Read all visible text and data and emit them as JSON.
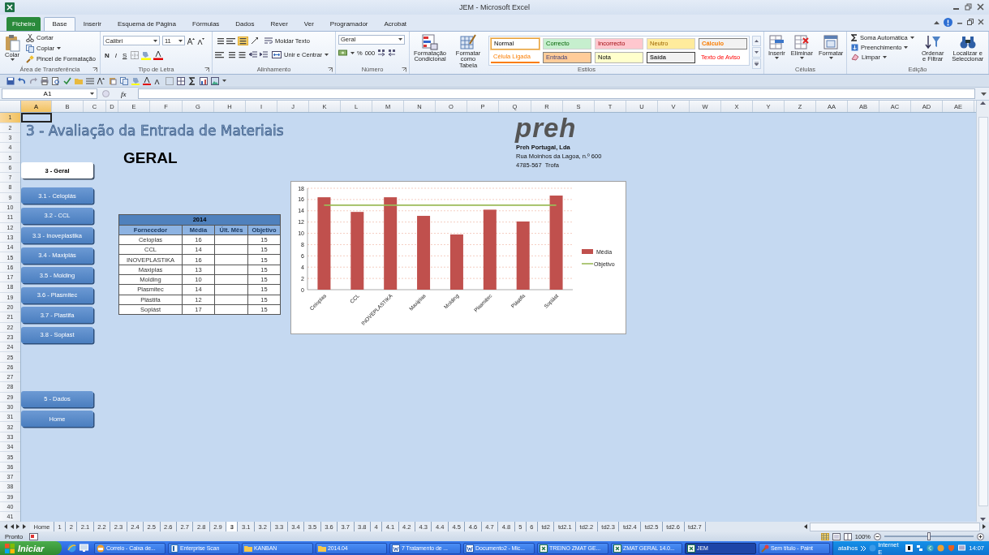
{
  "title_bar": {
    "title": "JEM - Microsoft Excel"
  },
  "ribbon_tabs": [
    {
      "label": "Ficheiro",
      "kind": "file",
      "selected": false
    },
    {
      "label": "Base",
      "kind": "tab",
      "selected": true
    },
    {
      "label": "Inserir",
      "kind": "tab",
      "selected": false
    },
    {
      "label": "Esquema de Página",
      "kind": "tab",
      "selected": false
    },
    {
      "label": "Fórmulas",
      "kind": "tab",
      "selected": false
    },
    {
      "label": "Dados",
      "kind": "tab",
      "selected": false
    },
    {
      "label": "Rever",
      "kind": "tab",
      "selected": false
    },
    {
      "label": "Ver",
      "kind": "tab",
      "selected": false
    },
    {
      "label": "Programador",
      "kind": "tab",
      "selected": false
    },
    {
      "label": "Acrobat",
      "kind": "tab",
      "selected": false
    }
  ],
  "ribbon": {
    "clipboard": {
      "label": "Área de Transferência",
      "paste": "Colar",
      "cut": "Cortar",
      "copy": "Copiar",
      "format_painter": "Pincel de Formatação"
    },
    "font": {
      "label": "Tipo de Letra",
      "name": "Calibri",
      "size": "11",
      "buttons": [
        "N",
        "I",
        "S"
      ]
    },
    "alignment": {
      "label": "Alinhamento",
      "wrap": "Moldar Texto",
      "merge": "Unir e Centrar"
    },
    "number": {
      "label": "Número",
      "format": "Geral",
      "percent": "%",
      "thousands": "000"
    },
    "styles": {
      "label": "Estilos",
      "conditional": "Formatação Condicional",
      "as_table": "Formatar como Tabela",
      "items": [
        {
          "label": "Normal",
          "kind": "normal",
          "color": "#ffffff",
          "selected": true
        },
        {
          "label": "Correcto",
          "kind": "good",
          "color": "#c6efce",
          "selected": false
        },
        {
          "label": "Incorrecto",
          "kind": "bad",
          "color": "#ffc7ce",
          "selected": false
        },
        {
          "label": "Neutro",
          "kind": "neutral",
          "color": "#ffeb9c",
          "selected": false
        },
        {
          "label": "Cálculo",
          "kind": "calculation",
          "color": "#f2f2f2",
          "selected": false
        },
        {
          "label": "Célula Ligada",
          "kind": "linked",
          "color": "#ffffff",
          "selected": false
        },
        {
          "label": "Entrada",
          "kind": "input",
          "color": "#ffcc99",
          "selected": false
        },
        {
          "label": "Nota",
          "kind": "note",
          "color": "#ffffcc",
          "selected": false
        },
        {
          "label": "Saída",
          "kind": "output",
          "color": "#f2f2f2",
          "selected": false
        },
        {
          "label": "Texto de Aviso",
          "kind": "warning",
          "color": "#ffffff",
          "selected": false
        }
      ]
    },
    "cells": {
      "label": "Células",
      "insert": "Inserir",
      "delete": "Eliminar",
      "format": "Formatar"
    },
    "editing": {
      "label": "Edição",
      "autosum": "Soma Automática",
      "fill": "Preenchimento",
      "clear": "Limpar",
      "sort": "Ordenar e Filtrar",
      "find": "Localizar e Seleccionar"
    }
  },
  "formula_bar": {
    "name_box": "A1",
    "fx": "fx"
  },
  "sheet": {
    "columns": [
      {
        "label": "A",
        "selected": true
      },
      {
        "label": "B",
        "selected": false
      },
      {
        "label": "C",
        "selected": false
      },
      {
        "label": "D",
        "selected": false
      },
      {
        "label": "E",
        "selected": false
      },
      {
        "label": "F",
        "selected": false
      },
      {
        "label": "G",
        "selected": false
      },
      {
        "label": "H",
        "selected": false
      },
      {
        "label": "I",
        "selected": false
      },
      {
        "label": "J",
        "selected": false
      },
      {
        "label": "K",
        "selected": false
      },
      {
        "label": "L",
        "selected": false
      },
      {
        "label": "M",
        "selected": false
      },
      {
        "label": "N",
        "selected": false
      },
      {
        "label": "O",
        "selected": false
      },
      {
        "label": "P",
        "selected": false
      },
      {
        "label": "Q",
        "selected": false
      },
      {
        "label": "R",
        "selected": false
      },
      {
        "label": "S",
        "selected": false
      },
      {
        "label": "T",
        "selected": false
      },
      {
        "label": "U",
        "selected": false
      },
      {
        "label": "V",
        "selected": false
      },
      {
        "label": "W",
        "selected": false
      },
      {
        "label": "X",
        "selected": false
      },
      {
        "label": "Y",
        "selected": false
      },
      {
        "label": "Z",
        "selected": false
      },
      {
        "label": "AA",
        "selected": false
      },
      {
        "label": "AB",
        "selected": false
      },
      {
        "label": "AC",
        "selected": false
      },
      {
        "label": "AD",
        "selected": false
      },
      {
        "label": "AE",
        "selected": false
      }
    ],
    "rows": [
      {
        "label": "1",
        "selected": true
      },
      {
        "label": "2",
        "selected": false
      },
      {
        "label": "3",
        "selected": false
      },
      {
        "label": "4",
        "selected": false
      },
      {
        "label": "5",
        "selected": false
      },
      {
        "label": "6",
        "selected": false
      },
      {
        "label": "7",
        "selected": false
      },
      {
        "label": "8",
        "selected": false
      },
      {
        "label": "9",
        "selected": false
      },
      {
        "label": "10",
        "selected": false
      },
      {
        "label": "11",
        "selected": false
      },
      {
        "label": "12",
        "selected": false
      },
      {
        "label": "13",
        "selected": false
      },
      {
        "label": "14",
        "selected": false
      },
      {
        "label": "15",
        "selected": false
      },
      {
        "label": "16",
        "selected": false
      },
      {
        "label": "17",
        "selected": false
      },
      {
        "label": "18",
        "selected": false
      },
      {
        "label": "19",
        "selected": false
      },
      {
        "label": "20",
        "selected": false
      },
      {
        "label": "21",
        "selected": false
      },
      {
        "label": "22",
        "selected": false
      },
      {
        "label": "23",
        "selected": false
      },
      {
        "label": "24",
        "selected": false
      },
      {
        "label": "25",
        "selected": false
      },
      {
        "label": "26",
        "selected": false
      },
      {
        "label": "27",
        "selected": false
      },
      {
        "label": "28",
        "selected": false
      },
      {
        "label": "29",
        "selected": false
      },
      {
        "label": "30",
        "selected": false
      },
      {
        "label": "31",
        "selected": false
      },
      {
        "label": "32",
        "selected": false
      },
      {
        "label": "33",
        "selected": false
      },
      {
        "label": "34",
        "selected": false
      },
      {
        "label": "35",
        "selected": false
      },
      {
        "label": "36",
        "selected": false
      },
      {
        "label": "37",
        "selected": false
      },
      {
        "label": "38",
        "selected": false
      },
      {
        "label": "39",
        "selected": false
      },
      {
        "label": "40",
        "selected": false
      },
      {
        "label": "41",
        "selected": false
      }
    ],
    "title": "3 - Avaliação da Entrada de Materiais",
    "heading": "GERAL",
    "nav_groups": [
      [
        {
          "label": "3 - Geral",
          "selected": true
        }
      ],
      [
        {
          "label": "3.1 - Celoplás",
          "selected": false
        },
        {
          "label": "3.2 - CCL",
          "selected": false
        },
        {
          "label": "3.3 - Inoveplastika",
          "selected": false
        },
        {
          "label": "3.4 - Maxiplás",
          "selected": false
        },
        {
          "label": "3.5 - Molding",
          "selected": false
        },
        {
          "label": "3.6 - Plasmitec",
          "selected": false
        },
        {
          "label": "3.7 - Plastifa",
          "selected": false
        },
        {
          "label": "3.8 - Soplast",
          "selected": false
        }
      ],
      [
        {
          "label": "5 - Dados",
          "selected": false
        },
        {
          "label": "Home",
          "selected": false
        }
      ]
    ],
    "logo": "preh",
    "company": [
      "Preh Portugal, Lda",
      "Rua Moinhos da Lagoa, n.º 600",
      "4785-567  Trofa"
    ],
    "table": {
      "year": "2014",
      "columns": [
        "Fornecedor",
        "Média",
        "Últ. Mês",
        "Objetivo"
      ],
      "rows": [
        {
          "supplier": "Celoplas",
          "media": "16",
          "objective": "15"
        },
        {
          "supplier": "CCL",
          "media": "14",
          "objective": "15"
        },
        {
          "supplier": "INOVEPLASTIKA",
          "media": "16",
          "objective": "15"
        },
        {
          "supplier": "Maxiplas",
          "media": "13",
          "objective": "15"
        },
        {
          "supplier": "Molding",
          "media": "10",
          "objective": "15"
        },
        {
          "supplier": "Plasmitec",
          "media": "14",
          "objective": "15"
        },
        {
          "supplier": "Plástifa",
          "media": "12",
          "objective": "15"
        },
        {
          "supplier": "Soplást",
          "media": "17",
          "objective": "15"
        }
      ]
    },
    "chart": {
      "chart_data": {
        "type": "bar",
        "categories": [
          "Celoplas",
          "CCL",
          "INOVEPLASTIKA",
          "Maxiplas",
          "Molding",
          "Plasmitec",
          "Plástifa",
          "Soplást"
        ],
        "legend": "right",
        "grid": true,
        "ylim": [
          0,
          18
        ],
        "yticks": [
          0,
          2,
          4,
          6,
          8,
          10,
          12,
          14,
          16,
          18
        ],
        "series": [
          {
            "name": "Média",
            "color": "#c0504d",
            "values": [
              16.4,
              13.8,
              16.4,
              13.1,
              9.8,
              14.2,
              12.1,
              16.7
            ]
          },
          {
            "name": "Objetivo",
            "type": "line",
            "color": "#9bbb59",
            "values": [
              15,
              15,
              15,
              15,
              15,
              15,
              15,
              15
            ]
          }
        ]
      }
    }
  },
  "sheet_tabs": [
    {
      "label": "Home",
      "selected": false
    },
    {
      "label": "1",
      "selected": false
    },
    {
      "label": "2",
      "selected": false
    },
    {
      "label": "2.1",
      "selected": false
    },
    {
      "label": "2.2",
      "selected": false
    },
    {
      "label": "2.3",
      "selected": false
    },
    {
      "label": "2.4",
      "selected": false
    },
    {
      "label": "2.5",
      "selected": false
    },
    {
      "label": "2.6",
      "selected": false
    },
    {
      "label": "2.7",
      "selected": false
    },
    {
      "label": "2.8",
      "selected": false
    },
    {
      "label": "2.9",
      "selected": false
    },
    {
      "label": "3",
      "selected": true
    },
    {
      "label": "3.1",
      "selected": false
    },
    {
      "label": "3.2",
      "selected": false
    },
    {
      "label": "3.3",
      "selected": false
    },
    {
      "label": "3.4",
      "selected": false
    },
    {
      "label": "3.5",
      "selected": false
    },
    {
      "label": "3.6",
      "selected": false
    },
    {
      "label": "3.7",
      "selected": false
    },
    {
      "label": "3.8",
      "selected": false
    },
    {
      "label": "4",
      "selected": false
    },
    {
      "label": "4.1",
      "selected": false
    },
    {
      "label": "4.2",
      "selected": false
    },
    {
      "label": "4.3",
      "selected": false
    },
    {
      "label": "4.4",
      "selected": false
    },
    {
      "label": "4.5",
      "selected": false
    },
    {
      "label": "4.6",
      "selected": false
    },
    {
      "label": "4.7",
      "selected": false
    },
    {
      "label": "4.8",
      "selected": false
    },
    {
      "label": "5",
      "selected": false
    },
    {
      "label": "6",
      "selected": false
    },
    {
      "label": "td2",
      "selected": false
    },
    {
      "label": "td2.1",
      "selected": false
    },
    {
      "label": "td2.2",
      "selected": false
    },
    {
      "label": "td2.3",
      "selected": false
    },
    {
      "label": "td2.4",
      "selected": false
    },
    {
      "label": "td2.5",
      "selected": false
    },
    {
      "label": "td2.6",
      "selected": false
    },
    {
      "label": "td2.7",
      "selected": false
    }
  ],
  "status_bar": {
    "status": "Pronto",
    "zoom": "100%",
    "zoom_slider": {
      "level": 0.5
    }
  },
  "taskbar": {
    "start": "Iniciar",
    "tasks": [
      {
        "label": "Correio - Caixa de...",
        "kind": "mail",
        "selected": false
      },
      {
        "label": "Enterprise Scan",
        "kind": "app",
        "selected": false
      },
      {
        "label": "KANBAN",
        "kind": "folder",
        "selected": false
      },
      {
        "label": "2014.04",
        "kind": "folder",
        "selected": false
      },
      {
        "label": "7 Tratamento de ...",
        "kind": "word",
        "selected": false
      },
      {
        "label": "Documento2 - Mic...",
        "kind": "word",
        "selected": false
      },
      {
        "label": "TREINO ZMAT GE...",
        "kind": "excel",
        "selected": false
      },
      {
        "label": "ZMAT GERAL 14.0...",
        "kind": "excel",
        "selected": false
      },
      {
        "label": "JEM",
        "kind": "excel",
        "selected": true
      },
      {
        "label": "Sem título - Paint",
        "kind": "paint",
        "selected": false
      }
    ],
    "toolbar": "atalhos",
    "browser": "Internet E",
    "clock": "14:07"
  }
}
